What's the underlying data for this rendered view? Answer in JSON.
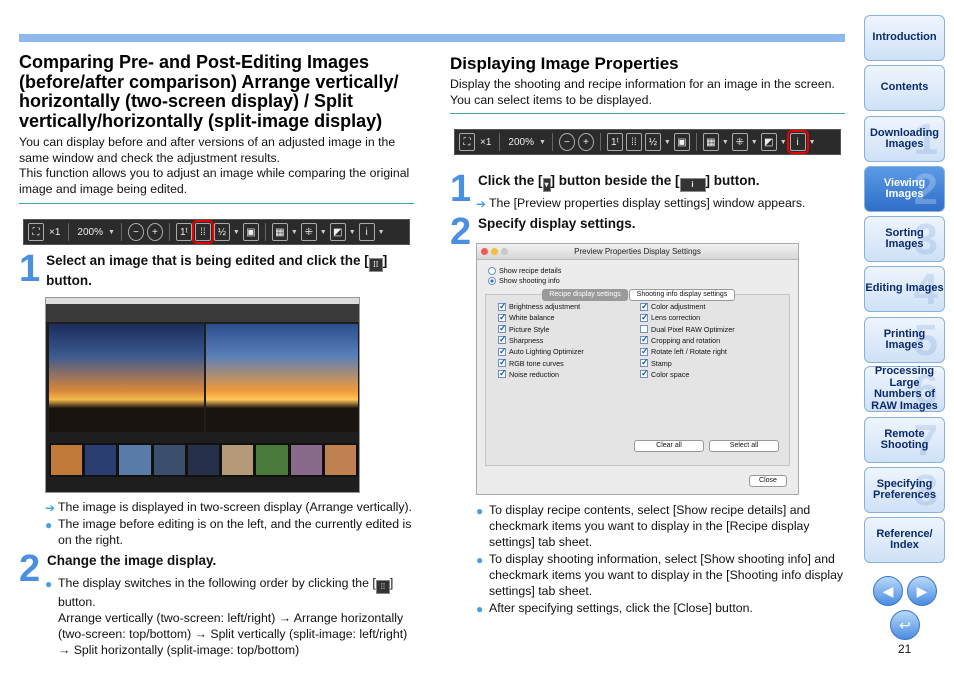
{
  "left": {
    "heading": "Comparing Pre- and Post-Editing Images (before/after comparison) Arrange vertically/ horizontally (two-screen display) / Split vertically/horizontally (split-image display)",
    "intro1": "You can display before and after versions of an adjusted image in the same window and check the adjustment results.",
    "intro2": "This function allows you to adjust an image while comparing the original image and image being edited.",
    "step1_num": "1",
    "step1_a": "Select an image that is being edited and click the [",
    "step1_b": "] button.",
    "note1": "The image is displayed in two-screen display (Arrange vertically).",
    "note2": "The image before editing is on the left, and the currently edited is on the right.",
    "step2_num": "2",
    "step2": "Change the image display.",
    "note3_a": "The display switches in the following order by clicking the [",
    "note3_b": "] button.",
    "note3_c": "Arrange vertically (two-screen: left/right) → Arrange horizontally (two-screen: top/bottom) → Split vertically (split-image: left/right) → Split horizontally (split-image: top/bottom)"
  },
  "right": {
    "heading": "Displaying Image Properties",
    "intro": "Display the shooting and recipe information for an image in the screen. You can select items to be displayed.",
    "step1_num": "1",
    "step1_a": "Click the [",
    "step1_b": "] button beside the [",
    "step1_c": "] button.",
    "note1": "The [Preview properties display settings] window appears.",
    "step2_num": "2",
    "step2": "Specify display settings.",
    "note2": "To display recipe contents, select [Show recipe details] and checkmark items you want to display in the [Recipe display settings] tab sheet.",
    "note3": "To display shooting information, select [Show shooting info] and checkmark items you want to display in the [Shooting info display settings] tab sheet.",
    "note4": "After specifying settings, click the [Close] button."
  },
  "toolbar": {
    "zoom1": "×1",
    "zoom2": "200%"
  },
  "dialog": {
    "title": "Preview Properties Display Settings",
    "radio1": "Show recipe details",
    "radio2": "Show shooting info",
    "tab1": "Recipe display settings",
    "tab2": "Shooting info display settings",
    "items_left": [
      "Brightness adjustment",
      "White balance",
      "Picture Style",
      "Sharpness",
      "Auto Lighting Optimizer",
      "RGB tone curves",
      "Noise reduction"
    ],
    "items_right": [
      "Color adjustment",
      "Lens correction",
      "Dual Pixel RAW Optimizer",
      "Cropping and rotation",
      "Rotate left / Rotate right",
      "Stamp",
      "Color space"
    ],
    "clear_all": "Clear all",
    "select_all": "Select all",
    "close": "Close"
  },
  "sidebar": [
    {
      "label": "Introduction",
      "wm": ""
    },
    {
      "label": "Contents",
      "wm": ""
    },
    {
      "label": "Downloading Images",
      "wm": "1"
    },
    {
      "label": "Viewing Images",
      "wm": "2"
    },
    {
      "label": "Sorting Images",
      "wm": "3"
    },
    {
      "label": "Editing Images",
      "wm": "4"
    },
    {
      "label": "Printing Images",
      "wm": "5"
    },
    {
      "label": "Processing Large Numbers of RAW Images",
      "wm": "6"
    },
    {
      "label": "Remote Shooting",
      "wm": "7"
    },
    {
      "label": "Specifying Preferences",
      "wm": "8"
    },
    {
      "label": "Reference/ Index",
      "wm": ""
    }
  ],
  "page_number": "21",
  "icons": {
    "back": "left-arrow",
    "forward": "right-arrow",
    "return": "return-icon"
  }
}
